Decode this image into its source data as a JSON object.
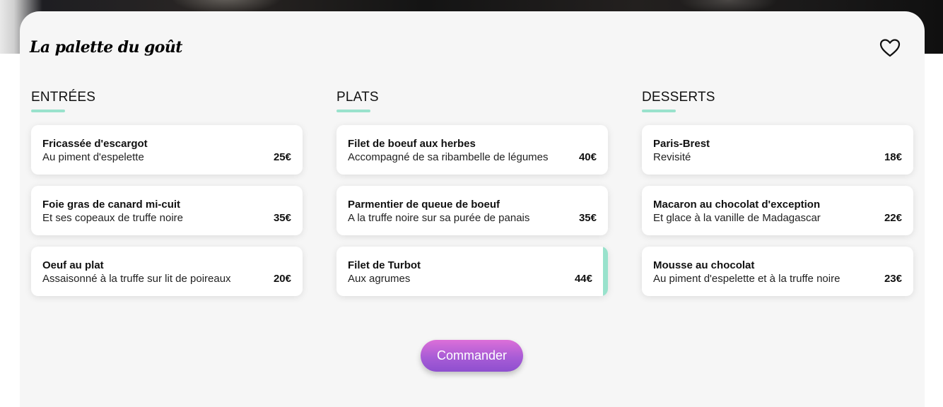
{
  "brand": {
    "name": "La palette du goût"
  },
  "favorite_icon": "heart-outline-icon",
  "menu": {
    "starters": {
      "title": "ENTRÉES",
      "items": [
        {
          "name": "Fricassée d'escargot",
          "description": "Au piment d'espelette",
          "price": "25€"
        },
        {
          "name": "Foie gras de canard mi-cuit",
          "description": "Et ses copeaux de truffe noire",
          "price": "35€"
        },
        {
          "name": "Oeuf au plat",
          "description": "Assaisonné à la truffe sur lit de poireaux",
          "price": "20€"
        }
      ]
    },
    "mains": {
      "title": "PLATS",
      "items": [
        {
          "name": "Filet de boeuf aux herbes",
          "description": "Accompagné de sa ribambelle de légumes",
          "price": "40€"
        },
        {
          "name": "Parmentier de queue de boeuf",
          "description": "A la truffe noire sur sa purée de panais",
          "price": "35€"
        },
        {
          "name": "Filet de Turbot",
          "description": "Aux agrumes",
          "price": "44€",
          "selected": true
        }
      ]
    },
    "desserts": {
      "title": "DESSERTS",
      "items": [
        {
          "name": "Paris-Brest",
          "description": "Revisité",
          "price": "18€"
        },
        {
          "name": "Macaron au chocolat d'exception",
          "description": "Et glace à la vanille de Madagascar",
          "price": "22€"
        },
        {
          "name": "Mousse au chocolat",
          "description": "Au piment d'espelette et à la truffe noire",
          "price": "23€"
        }
      ]
    }
  },
  "order_button": {
    "label": "Commander"
  },
  "colors": {
    "accent": "#99e2cc",
    "button_top": "#dc6fd8",
    "button_bottom": "#8e4fcf",
    "card_background": "#f6f6f6"
  }
}
